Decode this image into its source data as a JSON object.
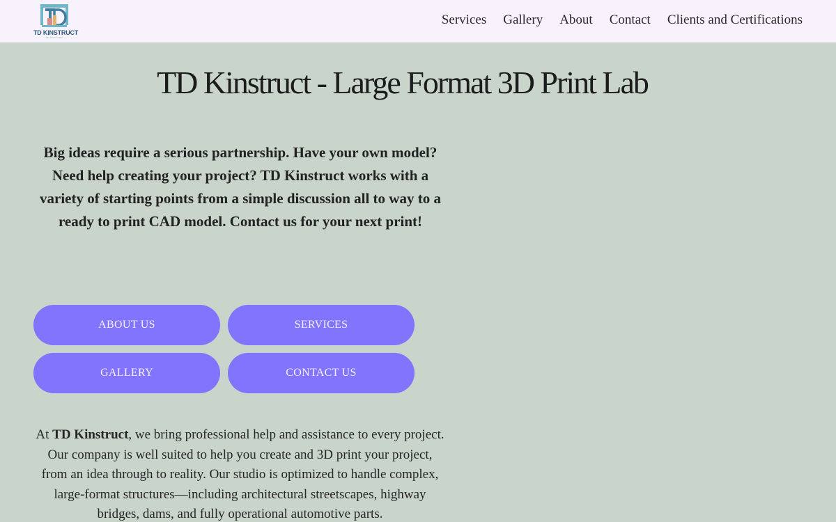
{
  "header": {
    "logo_text": "TD KINSTRUCT",
    "logo_tagline": "3D PRINTING",
    "nav": [
      "Services",
      "Gallery",
      "About",
      "Contact",
      "Clients and Certifications"
    ]
  },
  "main": {
    "title": "TD Kinstruct - Large Format 3D Print Lab",
    "intro": "Big ideas require a serious partnership. Have your own model?  Need help creating your project?  TD Kinstruct works with a variety of starting points from a simple discussion all to way to a ready to print CAD model.  Contact us for your next print!",
    "buttons": [
      "ABOUT US",
      "SERVICES",
      "GALLERY",
      "CONTACT US"
    ],
    "body_prefix": "At ",
    "body_brand": "TD Kinstruct",
    "body_rest": ", we bring professional help and assistance to every project. Our company is well suited to help you create and 3D print your project, from an idea through to reality.  Our studio is optimized to handle complex, large-format structures—including architectural streetscapes, highway bridges, dams, and fully operational automotive parts."
  },
  "colors": {
    "page_bg": "#c9d4cb",
    "header_bg": "#f8f2fc",
    "button_bg": "#8274fd",
    "button_text": "#f4f1ff",
    "logo_accent": "#6fb7c9"
  }
}
